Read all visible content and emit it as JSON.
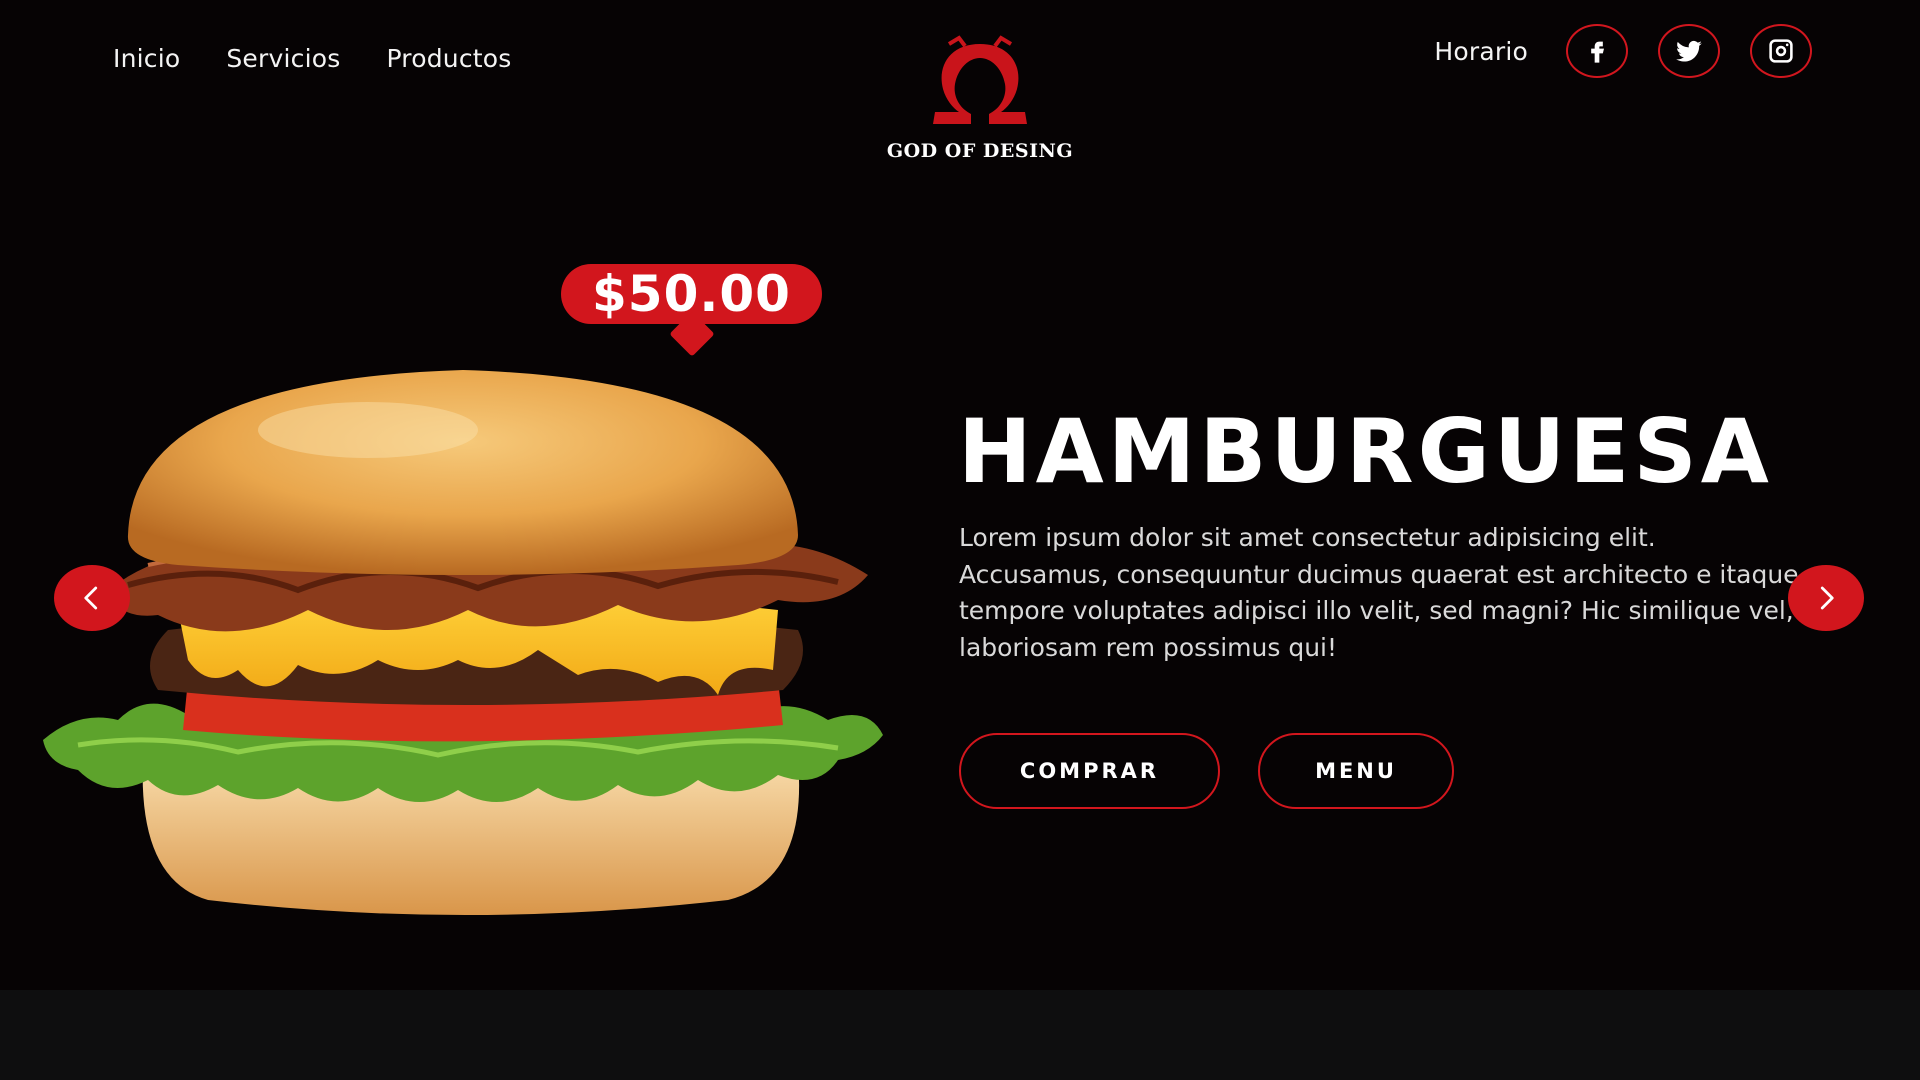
{
  "nav": {
    "links": [
      "Inicio",
      "Servicios",
      "Productos"
    ],
    "right_link": "Horario",
    "social": [
      {
        "name": "facebook-icon"
      },
      {
        "name": "twitter-icon"
      },
      {
        "name": "instagram-icon"
      }
    ]
  },
  "logo": {
    "text": "GOD OF DESING"
  },
  "product": {
    "price": "$50.00",
    "title": "HAMBURGUESA",
    "description": "Lorem ipsum dolor sit amet consectetur adipisicing elit. Accusamus, consequuntur ducimus quaerat est architecto e itaque tempore voluptates adipisci illo velit, sed magni? Hic similique vel, laboriosam rem possimus qui!",
    "buy_label": "COMPRAR",
    "menu_label": "MENU"
  },
  "carousel": {
    "prev_icon": "chevron-left-icon",
    "next_icon": "chevron-right-icon"
  },
  "colors": {
    "accent": "#d2161d",
    "background": "#060304",
    "footer": "#0e0e0f"
  }
}
